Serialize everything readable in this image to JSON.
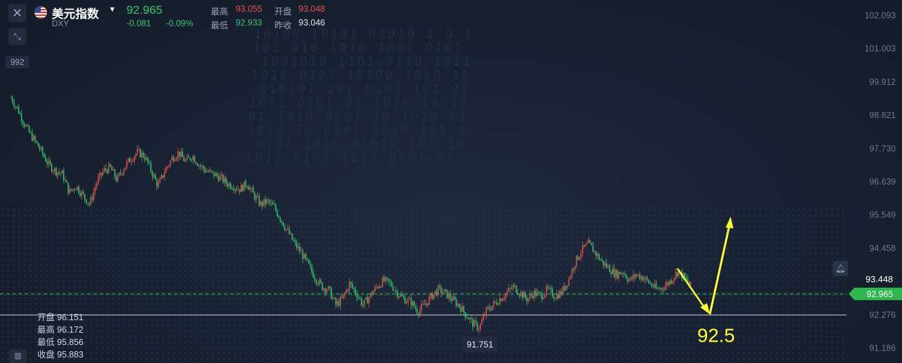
{
  "header": {
    "symbol_name": "美元指数",
    "symbol_code": "DXY",
    "last_price": "92.965",
    "change": "-0.081",
    "change_pct": "-0.09%",
    "high_label": "最高",
    "high_value": "93.055",
    "open_label": "开盘",
    "open_value": "93.048",
    "low_label": "最低",
    "low_value": "92.933",
    "prev_close_label": "昨收",
    "prev_close_value": "93.046"
  },
  "left_tag": "992",
  "ohlc_panel": {
    "open_label": "开盘",
    "open_value": "96.151",
    "high_label": "最高",
    "high_value": "96.172",
    "low_label": "最低",
    "low_value": "95.856",
    "close_label": "收盘",
    "close_value": "95.883"
  },
  "colors": {
    "background": "#1a2233",
    "up": "#e0524f",
    "down": "#2fc46e",
    "annotation": "#ffff2e",
    "current_tag": "#2fb64f"
  },
  "icons": {
    "close": "close-icon",
    "collapse": "collapse-icon",
    "flag": "us-flag-icon",
    "bell": "bell-icon"
  },
  "chart_data": {
    "type": "candlestick",
    "y_axis_ticks": [
      102.093,
      101.003,
      99.912,
      98.821,
      97.73,
      96.639,
      95.549,
      94.458,
      92.276,
      91.186
    ],
    "ylim": [
      90.7,
      102.6
    ],
    "price_tags": [
      {
        "value": 93.448,
        "label": "93.448",
        "style": "plain"
      },
      {
        "value": 92.965,
        "label": "92.965",
        "style": "current"
      }
    ],
    "horizontal_lines": [
      {
        "value": 92.965,
        "style": "dashed-green"
      },
      {
        "value": 92.276,
        "style": "solid-white"
      },
      {
        "value": 92.93,
        "style": "dotted-green"
      }
    ],
    "low_marker": {
      "value": 91.751,
      "label": "91.751"
    },
    "annotation": {
      "label": "92.5",
      "pivot_value": 92.3,
      "from_value": 93.8,
      "to_value": 95.5
    },
    "path": [
      [
        0,
        99.4
      ],
      [
        10,
        99.0
      ],
      [
        25,
        98.3
      ],
      [
        40,
        97.8
      ],
      [
        55,
        97.2
      ],
      [
        65,
        97.0
      ],
      [
        75,
        96.9
      ],
      [
        85,
        96.3
      ],
      [
        95,
        96.5
      ],
      [
        105,
        96.2
      ],
      [
        115,
        95.9
      ],
      [
        125,
        96.6
      ],
      [
        135,
        97.0
      ],
      [
        145,
        97.1
      ],
      [
        155,
        96.7
      ],
      [
        165,
        97.1
      ],
      [
        175,
        97.4
      ],
      [
        185,
        97.6
      ],
      [
        195,
        97.5
      ],
      [
        205,
        97.0
      ],
      [
        215,
        96.5
      ],
      [
        225,
        97.0
      ],
      [
        235,
        97.4
      ],
      [
        245,
        97.6
      ],
      [
        255,
        97.3
      ],
      [
        265,
        97.5
      ],
      [
        275,
        97.2
      ],
      [
        285,
        97.0
      ],
      [
        295,
        96.9
      ],
      [
        305,
        96.8
      ],
      [
        315,
        96.6
      ],
      [
        325,
        96.5
      ],
      [
        335,
        96.4
      ],
      [
        345,
        96.6
      ],
      [
        355,
        96.2
      ],
      [
        365,
        95.9
      ],
      [
        375,
        96.0
      ],
      [
        385,
        95.8
      ],
      [
        395,
        95.4
      ],
      [
        405,
        95.0
      ],
      [
        415,
        94.6
      ],
      [
        425,
        94.3
      ],
      [
        435,
        93.9
      ],
      [
        445,
        93.5
      ],
      [
        455,
        93.2
      ],
      [
        465,
        93.1
      ],
      [
        475,
        92.6
      ],
      [
        485,
        92.8
      ],
      [
        495,
        93.3
      ],
      [
        505,
        93.0
      ],
      [
        515,
        92.6
      ],
      [
        525,
        92.9
      ],
      [
        535,
        93.2
      ],
      [
        545,
        93.4
      ],
      [
        555,
        93.3
      ],
      [
        565,
        93.0
      ],
      [
        575,
        92.8
      ],
      [
        585,
        92.7
      ],
      [
        595,
        92.4
      ],
      [
        605,
        92.6
      ],
      [
        615,
        92.9
      ],
      [
        625,
        93.1
      ],
      [
        635,
        93.0
      ],
      [
        645,
        92.8
      ],
      [
        655,
        92.6
      ],
      [
        665,
        92.3
      ],
      [
        675,
        92.0
      ],
      [
        685,
        91.85
      ],
      [
        695,
        92.4
      ],
      [
        705,
        92.6
      ],
      [
        715,
        92.8
      ],
      [
        725,
        93.0
      ],
      [
        735,
        93.2
      ],
      [
        745,
        93.0
      ],
      [
        755,
        92.8
      ],
      [
        765,
        93.0
      ],
      [
        775,
        92.9
      ],
      [
        785,
        93.1
      ],
      [
        795,
        92.9
      ],
      [
        805,
        93.0
      ],
      [
        815,
        93.4
      ],
      [
        825,
        94.0
      ],
      [
        835,
        94.4
      ],
      [
        845,
        94.6
      ],
      [
        855,
        94.3
      ],
      [
        865,
        94.0
      ],
      [
        875,
        93.8
      ],
      [
        885,
        93.6
      ],
      [
        895,
        93.7
      ],
      [
        905,
        93.4
      ],
      [
        915,
        93.6
      ],
      [
        925,
        93.5
      ],
      [
        935,
        93.3
      ],
      [
        945,
        93.1
      ],
      [
        955,
        93.2
      ],
      [
        965,
        93.4
      ],
      [
        975,
        93.7
      ],
      [
        985,
        93.5
      ],
      [
        995,
        93.2
      ]
    ]
  }
}
